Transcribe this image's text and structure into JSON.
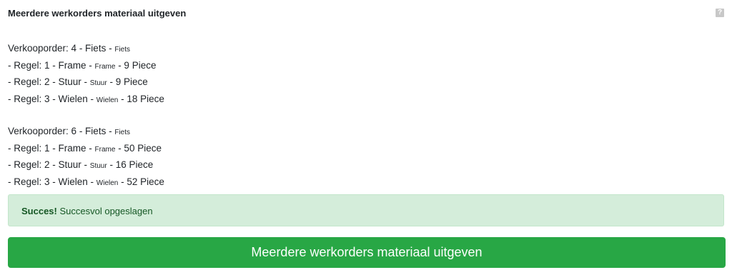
{
  "header": {
    "title": "Meerdere werkorders materiaal uitgeven",
    "help_icon": "?"
  },
  "orders": [
    {
      "label": "Verkooporder: 4 - Fiets - ",
      "sub": "Fiets",
      "lines": [
        {
          "prefix": "- Regel: 1 - Frame - ",
          "small": "Frame",
          "suffix": " - 9 Piece"
        },
        {
          "prefix": "- Regel: 2 - Stuur - ",
          "small": "Stuur",
          "suffix": " - 9 Piece"
        },
        {
          "prefix": "- Regel: 3 - Wielen - ",
          "small": "Wielen",
          "suffix": " - 18 Piece"
        }
      ]
    },
    {
      "label": "Verkooporder: 6 - Fiets - ",
      "sub": "Fiets",
      "lines": [
        {
          "prefix": "- Regel: 1 - Frame - ",
          "small": "Frame",
          "suffix": " - 50 Piece"
        },
        {
          "prefix": "- Regel: 2 - Stuur - ",
          "small": "Stuur",
          "suffix": " - 16 Piece"
        },
        {
          "prefix": "- Regel: 3 - Wielen - ",
          "small": "Wielen",
          "suffix": " - 52 Piece"
        }
      ]
    }
  ],
  "alert": {
    "strong": "Succes!",
    "text": " Succesvol opgeslagen"
  },
  "button": {
    "label": "Meerdere werkorders materiaal uitgeven"
  },
  "colors": {
    "success_bg": "#d4edda",
    "success_text": "#155724",
    "button_bg": "#28a745"
  }
}
